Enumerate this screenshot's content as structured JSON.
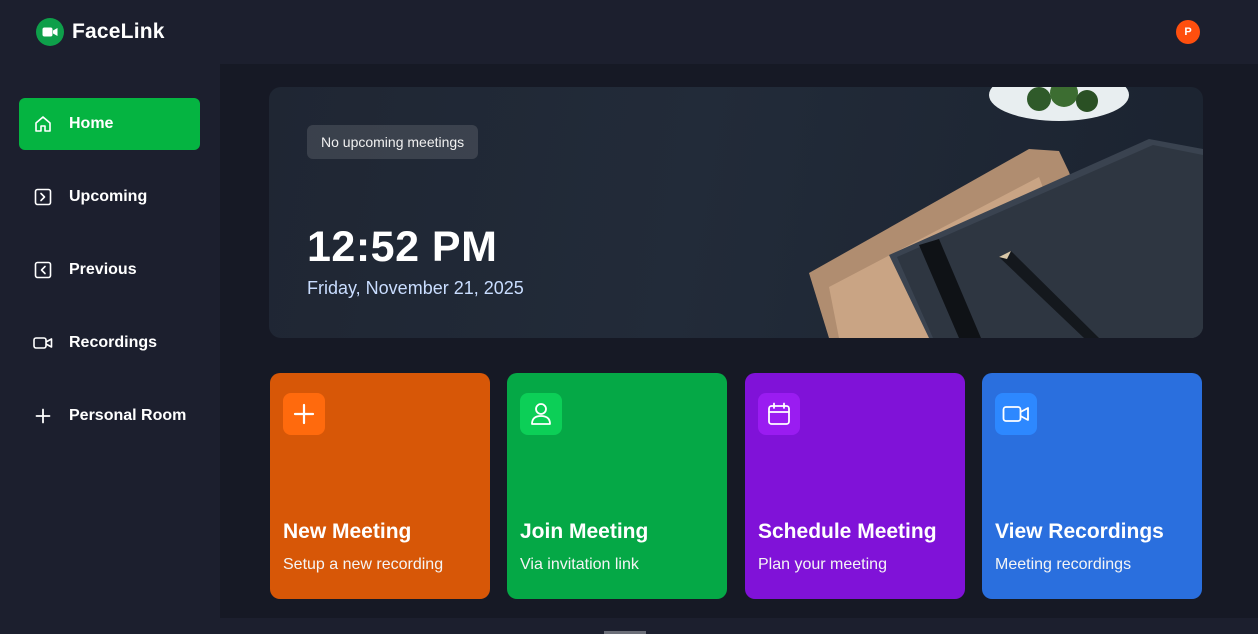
{
  "app": {
    "name": "FaceLink",
    "avatar_initial": "P"
  },
  "sidebar": {
    "items": [
      {
        "label": "Home",
        "icon": "home-icon",
        "active": true
      },
      {
        "label": "Upcoming",
        "icon": "upcoming-icon",
        "active": false
      },
      {
        "label": "Previous",
        "icon": "previous-icon",
        "active": false
      },
      {
        "label": "Recordings",
        "icon": "video-icon",
        "active": false
      },
      {
        "label": "Personal Room",
        "icon": "plus-icon",
        "active": false
      }
    ]
  },
  "hero": {
    "badge": "No upcoming meetings",
    "time": "12:52 PM",
    "date": "Friday, November 21, 2025"
  },
  "cards": [
    {
      "title": "New Meeting",
      "subtitle": "Setup a new recording",
      "icon": "plus-icon",
      "color": "#d75707"
    },
    {
      "title": "Join Meeting",
      "subtitle": "Via invitation link",
      "icon": "user-icon",
      "color": "#05a846"
    },
    {
      "title": "Schedule Meeting",
      "subtitle": "Plan your meeting",
      "icon": "calendar-icon",
      "color": "#8012d8"
    },
    {
      "title": "View Recordings",
      "subtitle": "Meeting recordings",
      "icon": "video-icon",
      "color": "#2a6fde"
    }
  ],
  "colors": {
    "accent": "#05b441",
    "background": "#1c1f2e",
    "main_background": "#161925"
  }
}
